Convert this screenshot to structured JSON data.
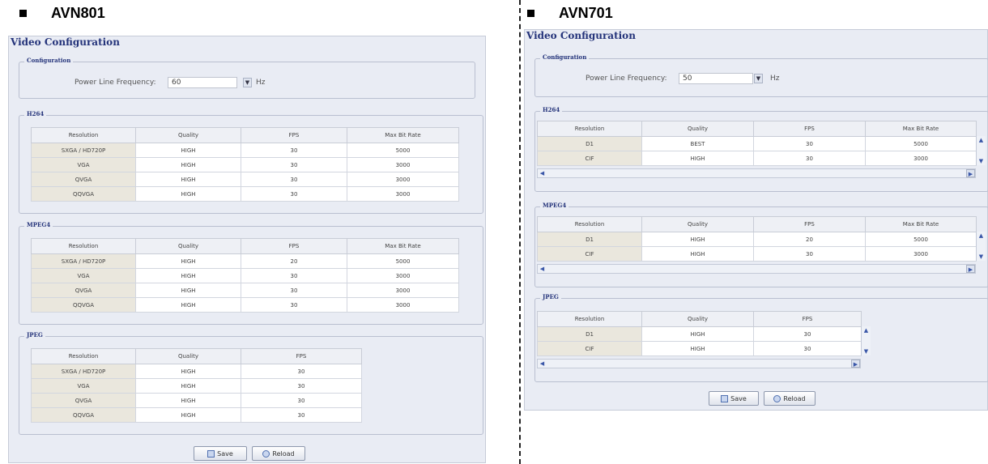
{
  "left": {
    "model": "AVN801",
    "panel_title": "Video Configuration",
    "config_legend": "Configuration",
    "plf_label": "Power Line Frequency:",
    "plf_value": "60",
    "plf_unit": "Hz",
    "sections": [
      {
        "legend": "H264",
        "headers": [
          "Resolution",
          "Quality",
          "FPS",
          "Max Bit Rate"
        ],
        "rows": [
          [
            "SXGA / HD720P",
            "HIGH",
            "30",
            "5000"
          ],
          [
            "VGA",
            "HIGH",
            "30",
            "3000"
          ],
          [
            "QVGA",
            "HIGH",
            "30",
            "3000"
          ],
          [
            "QQVGA",
            "HIGH",
            "30",
            "3000"
          ]
        ]
      },
      {
        "legend": "MPEG4",
        "headers": [
          "Resolution",
          "Quality",
          "FPS",
          "Max Bit Rate"
        ],
        "rows": [
          [
            "SXGA / HD720P",
            "HIGH",
            "20",
            "5000"
          ],
          [
            "VGA",
            "HIGH",
            "30",
            "3000"
          ],
          [
            "QVGA",
            "HIGH",
            "30",
            "3000"
          ],
          [
            "QQVGA",
            "HIGH",
            "30",
            "3000"
          ]
        ]
      },
      {
        "legend": "JPEG",
        "headers": [
          "Resolution",
          "Quality",
          "FPS"
        ],
        "rows": [
          [
            "SXGA / HD720P",
            "HIGH",
            "30"
          ],
          [
            "VGA",
            "HIGH",
            "30"
          ],
          [
            "QVGA",
            "HIGH",
            "30"
          ],
          [
            "QQVGA",
            "HIGH",
            "30"
          ]
        ]
      }
    ],
    "save_label": "Save",
    "reload_label": "Reload"
  },
  "right": {
    "model": "AVN701",
    "panel_title": "Video Configuration",
    "config_legend": "Configuration",
    "plf_label": "Power Line Frequency:",
    "plf_value": "50",
    "plf_unit": "Hz",
    "sections": [
      {
        "legend": "H264",
        "headers": [
          "Resolution",
          "Quality",
          "FPS",
          "Max Bit Rate"
        ],
        "rows": [
          [
            "D1",
            "BEST",
            "30",
            "5000"
          ],
          [
            "CIF",
            "HIGH",
            "30",
            "3000"
          ]
        ]
      },
      {
        "legend": "MPEG4",
        "headers": [
          "Resolution",
          "Quality",
          "FPS",
          "Max Bit Rate"
        ],
        "rows": [
          [
            "D1",
            "HIGH",
            "20",
            "5000"
          ],
          [
            "CIF",
            "HIGH",
            "30",
            "3000"
          ]
        ]
      },
      {
        "legend": "JPEG",
        "headers": [
          "Resolution",
          "Quality",
          "FPS"
        ],
        "rows": [
          [
            "D1",
            "HIGH",
            "30"
          ],
          [
            "CIF",
            "HIGH",
            "30"
          ]
        ]
      }
    ],
    "save_label": "Save",
    "reload_label": "Reload"
  },
  "icons": {
    "save": "save-icon",
    "reload": "reload-icon",
    "dropdown": "chevron-down-icon",
    "scroll_up": "arrow-up-icon",
    "scroll_down": "arrow-down-icon",
    "scroll_left": "arrow-left-icon",
    "scroll_right": "arrow-right-icon"
  },
  "colors": {
    "title": "#24337a",
    "panel_bg": "#e9ecf4",
    "res_col": "#eae7dd"
  }
}
